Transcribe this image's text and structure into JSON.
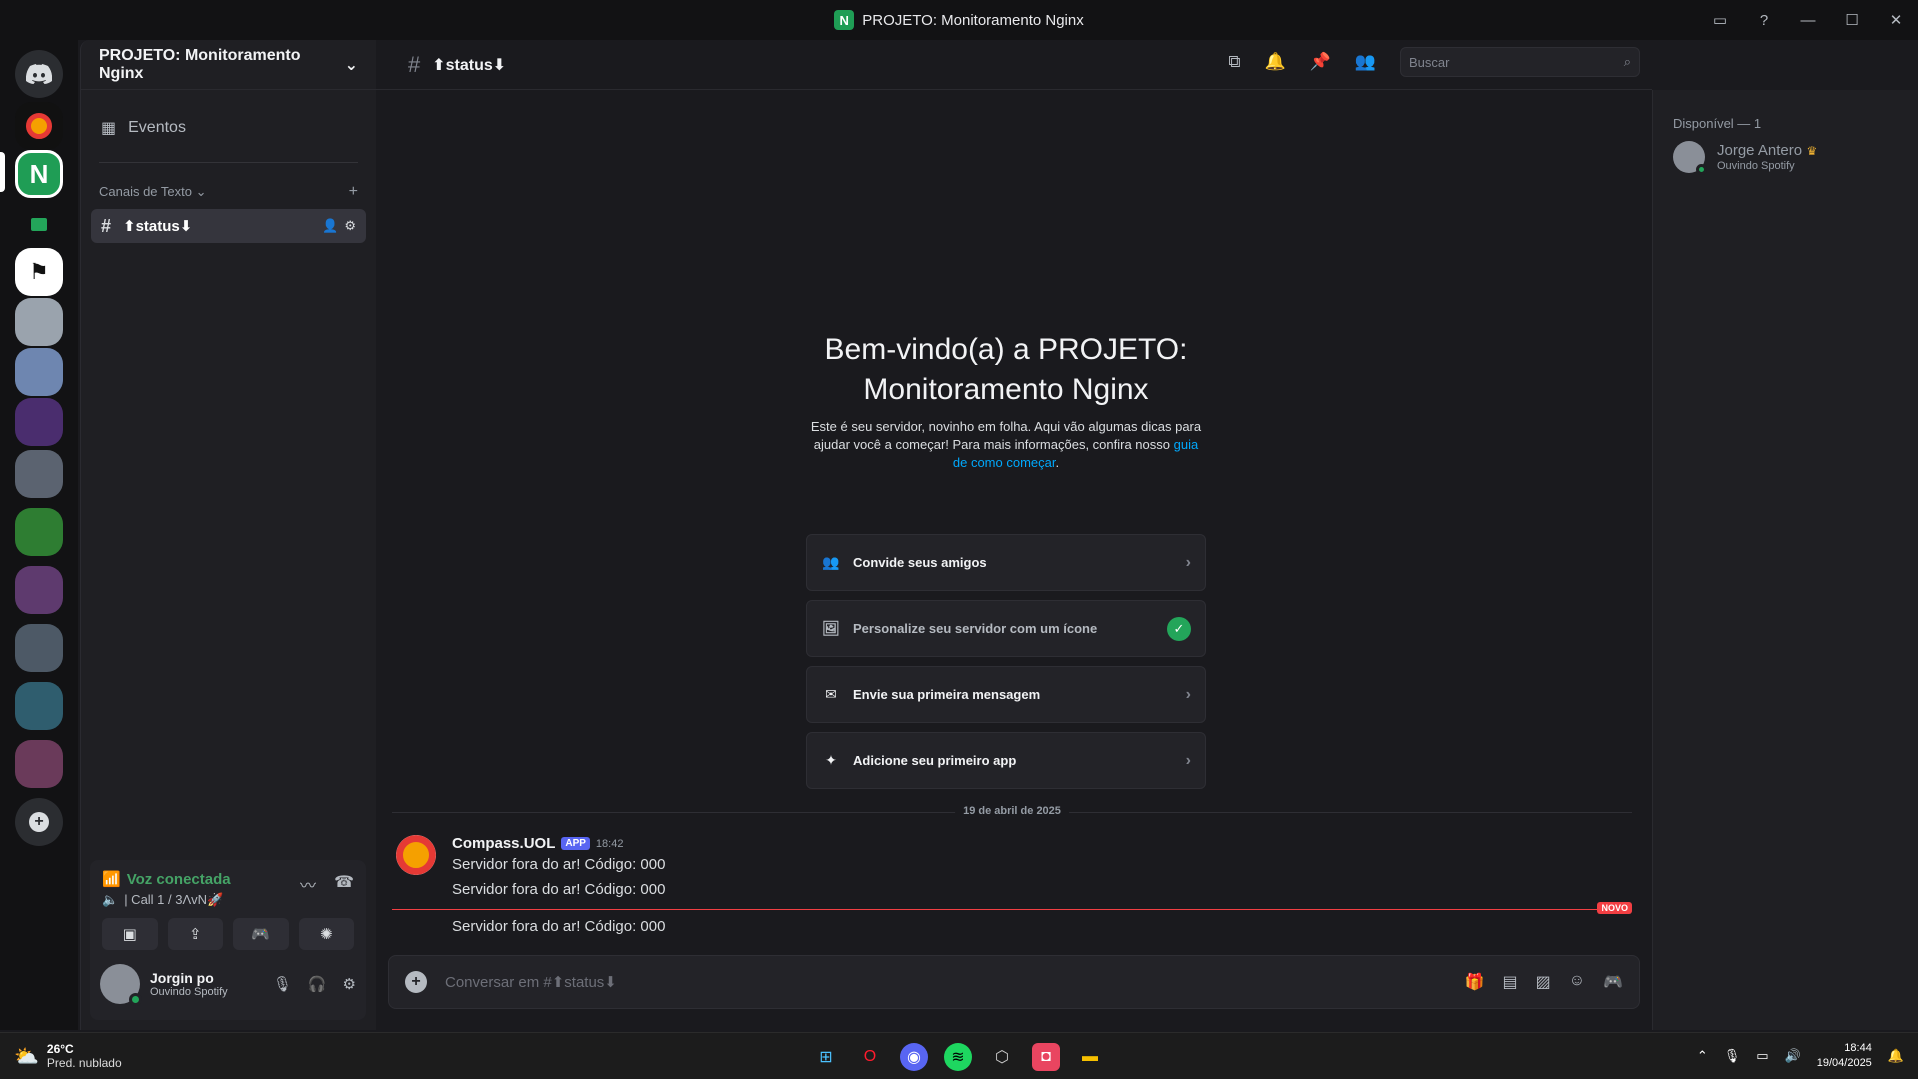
{
  "window": {
    "title": "PROJETO: Monitoramento Nginx",
    "app_badge": "N"
  },
  "rail": {
    "server_initial": "N",
    "add_server": "+"
  },
  "sidebar": {
    "guild_name": "PROJETO: Monitoramento Nginx",
    "events_label": "Eventos",
    "category_label": "Canais de Texto",
    "channel_name": "⬆status⬇"
  },
  "voice": {
    "status": "Voz conectada",
    "channel": "| Call 1 / 3ΛvN🚀"
  },
  "user": {
    "name": "Jorgin po",
    "activity": "Ouvindo Spotify"
  },
  "header": {
    "channel_name": "⬆status⬇",
    "search_placeholder": "Buscar"
  },
  "welcome": {
    "title": "Bem-vindo(a) a PROJETO: Monitoramento Nginx",
    "text": "Este é seu servidor, novinho em folha. Aqui vão algumas dicas para ajudar você a começar! Para mais informações, confira nosso",
    "link": "guia de como começar",
    "after": "."
  },
  "tasks": [
    {
      "label": "Convide seus amigos",
      "done": false,
      "icon": "👥"
    },
    {
      "label": "Personalize seu servidor com um ícone",
      "done": true,
      "icon": "🖼"
    },
    {
      "label": "Envie sua primeira mensagem",
      "done": false,
      "icon": "✉"
    },
    {
      "label": "Adicione seu primeiro app",
      "done": false,
      "icon": "✦"
    }
  ],
  "chat": {
    "date": "19 de abril de 2025",
    "author": "Compass.UOL",
    "app_tag": "APP",
    "time": "18:42",
    "lines": [
      "Servidor fora do ar! Código: 000",
      "Servidor fora do ar! Código: 000"
    ],
    "new_label": "NOVO",
    "after_new": "Servidor fora do ar! Código: 000",
    "composer_placeholder": "Conversar em #⬆status⬇"
  },
  "members": {
    "group_title": "Disponível — 1",
    "name": "Jorge Antero",
    "activity": "Ouvindo Spotify"
  },
  "taskbar": {
    "temp": "26°C",
    "condition": "Pred. nublado",
    "time": "18:44",
    "date": "19/04/2025"
  },
  "colors": {
    "accent": "#5865f2",
    "online": "#23a55a",
    "voice_green": "#45a366",
    "new_red": "#f23f43"
  }
}
